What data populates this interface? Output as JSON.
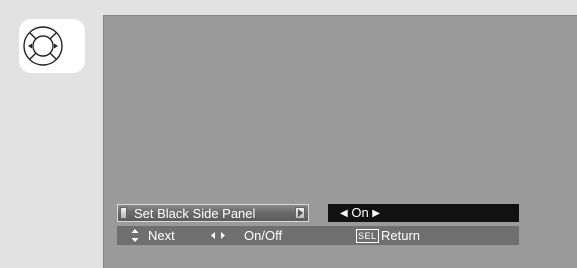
{
  "remote": {
    "icon": "directional-pad-icon"
  },
  "menu": {
    "setting_label": "Set Black Side Panel",
    "value": "On",
    "value_left_arrow": "◀",
    "value_right_arrow": "▶"
  },
  "help_bar": {
    "next_label": "Next",
    "toggle_label": "On/Off",
    "sel_key": "SEL",
    "return_label": "Return"
  },
  "colors": {
    "background": "#e2e2e2",
    "screen": "#9a9a9a",
    "value_box": "#111111",
    "help_bar": "#6f6f6f"
  }
}
